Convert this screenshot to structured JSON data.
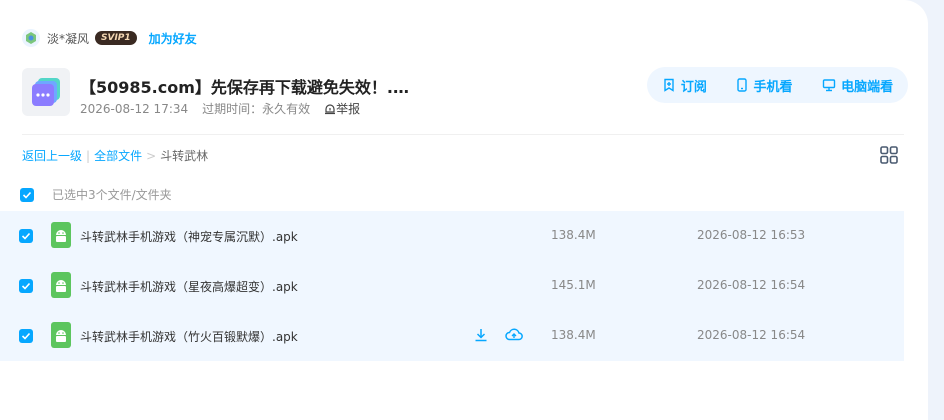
{
  "user": {
    "name": "淡*凝风",
    "badge": "SVIP1",
    "add_friend": "加为好友"
  },
  "share": {
    "title": "【50985.com】先保存再下载避免失效！.…",
    "date": "2026-08-12 17:34",
    "expiry": "过期时间：永久有效",
    "report": "举报"
  },
  "actions": {
    "subscribe": "订阅",
    "mobile": "手机看",
    "desktop": "电脑端看"
  },
  "breadcrumb": {
    "back": "返回上一级",
    "all_files": "全部文件",
    "separator_pipe": "|",
    "separator_arrow": ">",
    "current": "斗转武林"
  },
  "selection": {
    "text": "已选中3个文件/文件夹"
  },
  "files": [
    {
      "name": "斗转武林手机游戏（神宠专属沉默）.apk",
      "size": "138.4M",
      "date": "2026-08-12 16:53"
    },
    {
      "name": "斗转武林手机游戏（星夜高爆超变）.apk",
      "size": "145.1M",
      "date": "2026-08-12 16:54"
    },
    {
      "name": "斗转武林手机游戏（竹火百锻默爆）.apk",
      "size": "138.4M",
      "date": "2026-08-12 16:54"
    }
  ],
  "colors": {
    "accent": "#06a7ff",
    "row_bg": "#f0f7ff",
    "android_green": "#5cc55e"
  },
  "icons": {
    "avatar": "avatar-icon",
    "share_file": "share-file-icon",
    "report": "report-icon",
    "subscribe": "subscribe-icon",
    "mobile": "phone-icon",
    "desktop": "monitor-icon",
    "grid": "grid-view-icon",
    "checkbox": "checkbox-icon",
    "file": "android-apk-icon",
    "download": "download-icon",
    "save": "cloud-save-icon"
  }
}
